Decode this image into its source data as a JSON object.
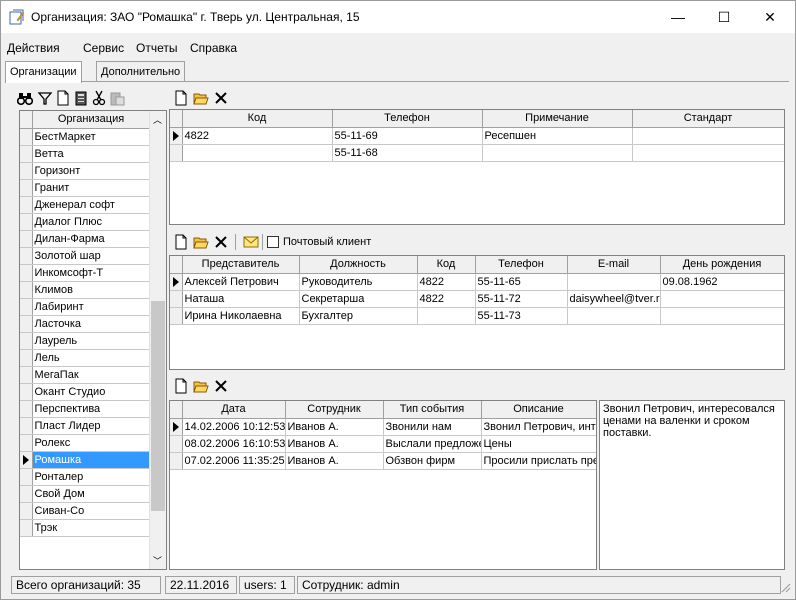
{
  "window": {
    "title": "Организация: ЗАО \"Ромашка\" г. Тверь ул. Центральная, 15",
    "minimize": "—",
    "maximize": "☐",
    "close": "✕"
  },
  "menu": [
    "Действия",
    "Сервис",
    "Отчеты",
    "Справка"
  ],
  "tabs": [
    "Организации",
    "Дополнительно"
  ],
  "org_list": {
    "header": "Организация",
    "items": [
      "БестМаркет",
      "Ветта",
      "Горизонт",
      "Гранит",
      "Дженерал софт",
      "Диалог Плюс",
      "Дилан-Фарма",
      "Золотой шар",
      "Инкомсофт-Т",
      "Климов",
      "Лабиринт",
      "Ласточка",
      "Лаурель",
      "Лель",
      "МегаПак",
      "Окант Студио",
      "Перспектива",
      "Пласт Лидер",
      "Ролекс",
      "Ромашка",
      "Ронталер",
      "Свой Дом",
      "Сиван-Со",
      "Трэк"
    ],
    "selected_index": 19
  },
  "phones_grid": {
    "columns": [
      "Код",
      "Телефон",
      "Примечание",
      "Стандарт"
    ],
    "rows": [
      [
        "4822",
        "55-11-69",
        "Ресепшен",
        ""
      ],
      [
        "",
        "55-11-68",
        "",
        ""
      ]
    ]
  },
  "mail_client_label": "Почтовый клиент",
  "contacts_grid": {
    "columns": [
      "Представитель",
      "Должность",
      "Код",
      "Телефон",
      "E-mail",
      "День рождения"
    ],
    "rows": [
      [
        "Алексей Петрович",
        "Руководитель",
        "4822",
        "55-11-65",
        "",
        "09.08.1962"
      ],
      [
        "Наташа",
        "Секретарша",
        "4822",
        "55-11-72",
        "daisywheel@tver.ru",
        ""
      ],
      [
        "Ирина Николаевна",
        "Бухгалтер",
        "",
        "55-11-73",
        "",
        ""
      ]
    ]
  },
  "events_grid": {
    "columns": [
      "Дата",
      "Сотрудник",
      "Тип события",
      "Описание"
    ],
    "rows": [
      [
        "14.02.2006 10:12:53",
        "Иванов А.",
        "Звонили нам",
        "Звонил Петрович, интересовался"
      ],
      [
        "08.02.2006 16:10:53",
        "Иванов А.",
        "Выслали предложение",
        "Цены"
      ],
      [
        "07.02.2006 11:35:25",
        "Иванов А.",
        "Обзвон фирм",
        "Просили прислать прейскурант"
      ]
    ]
  },
  "event_description": "Звонил Петрович, интересовался ценами на валенки и сроком поставки.",
  "status": {
    "total": "Всего организаций: 35",
    "date": "22.11.2016",
    "users": "users: 1",
    "employee": "Сотрудник: admin"
  }
}
